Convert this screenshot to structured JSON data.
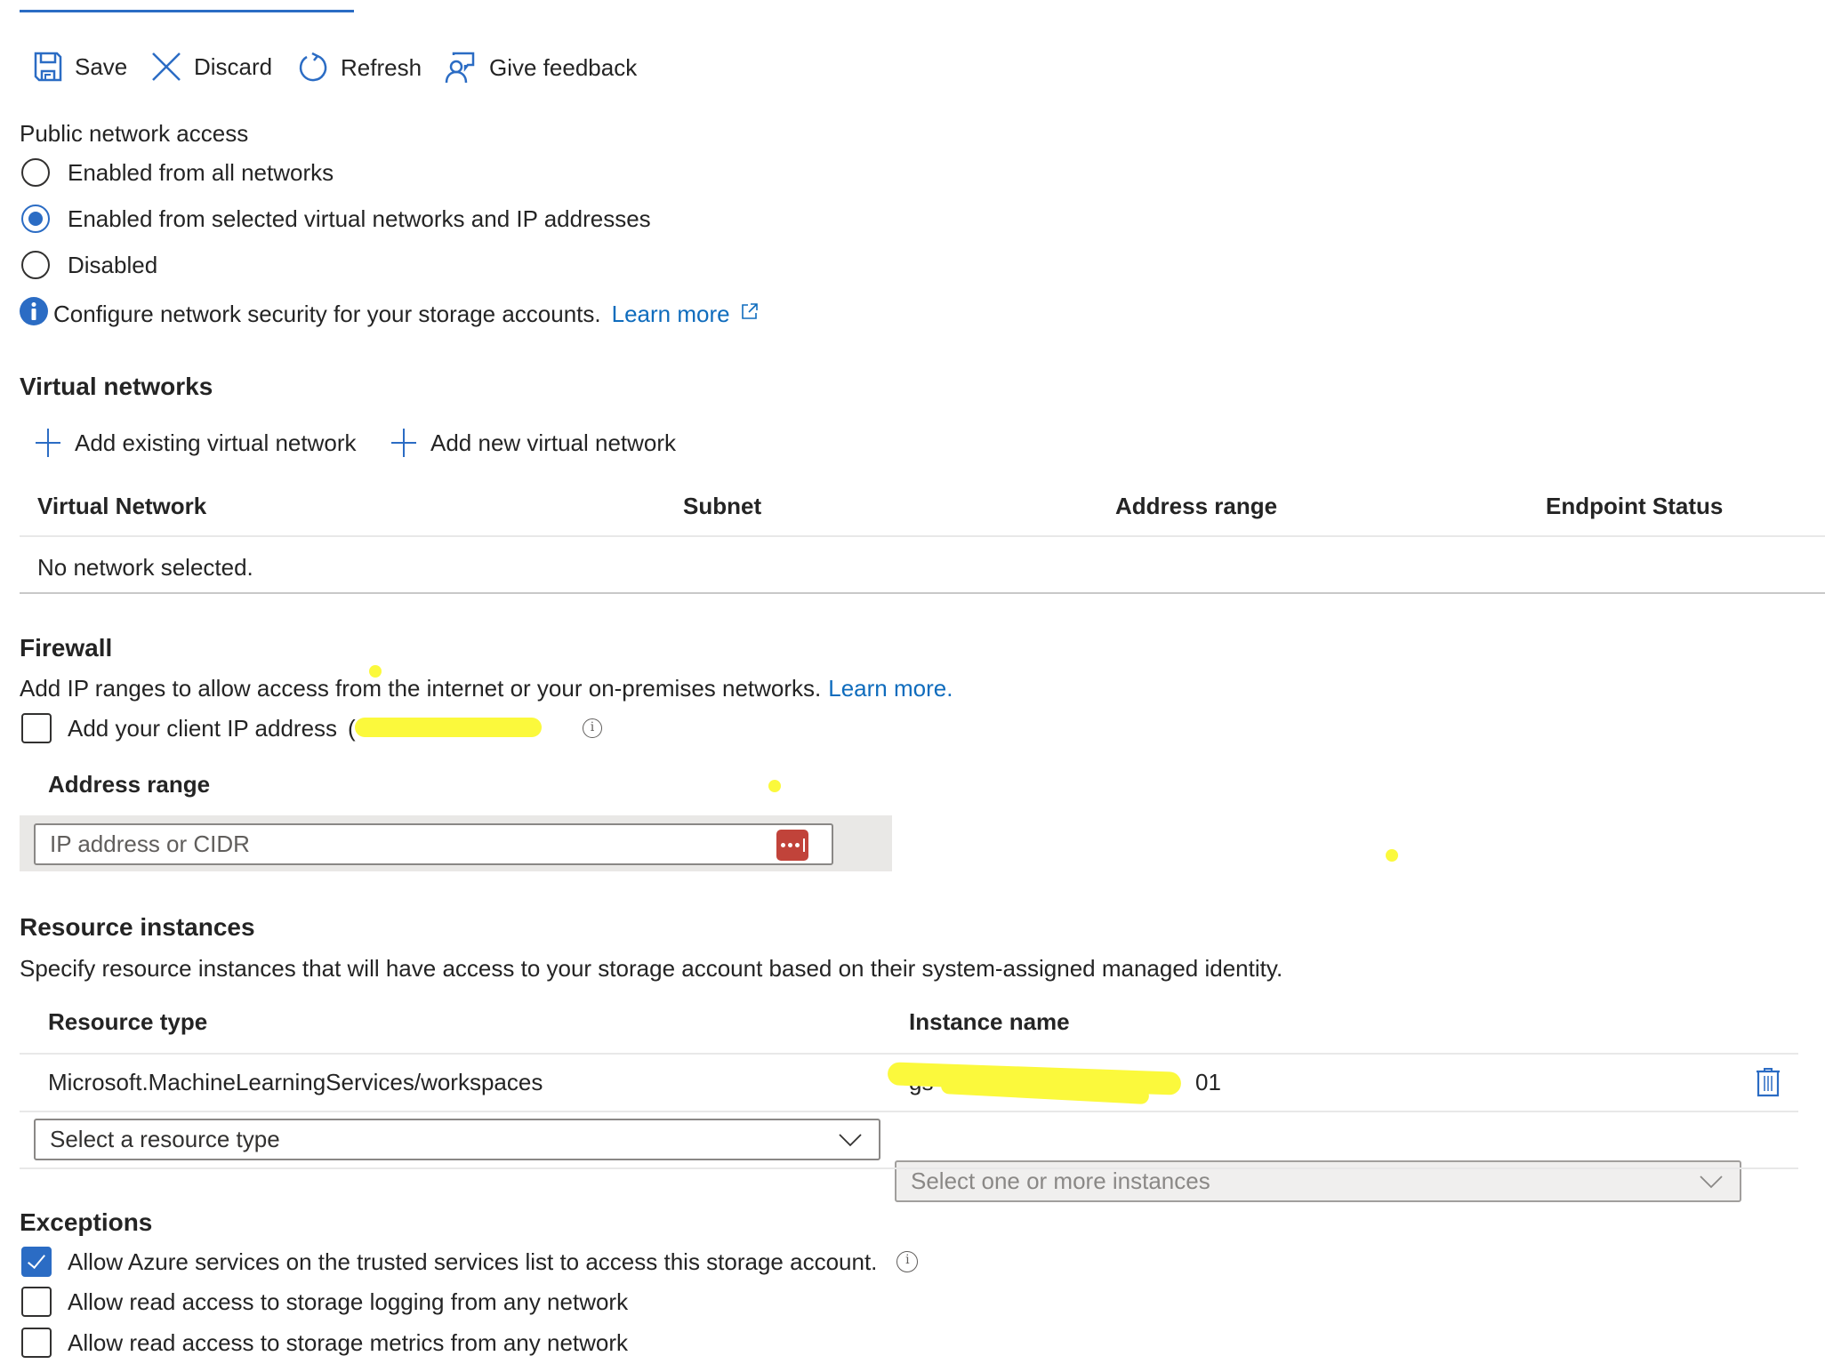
{
  "toolbar": {
    "save_label": "Save",
    "discard_label": "Discard",
    "refresh_label": "Refresh",
    "feedback_label": "Give feedback"
  },
  "public_access": {
    "title": "Public network access",
    "options": [
      {
        "label": "Enabled from all networks",
        "selected": false
      },
      {
        "label": "Enabled from selected virtual networks and IP addresses",
        "selected": true
      },
      {
        "label": "Disabled",
        "selected": false
      }
    ],
    "info_text": "Configure network security for your storage accounts.",
    "learn_more": "Learn more"
  },
  "virtual_networks": {
    "title": "Virtual networks",
    "add_existing": "Add existing virtual network",
    "add_new": "Add new virtual network",
    "columns": [
      "Virtual Network",
      "Subnet",
      "Address range",
      "Endpoint Status"
    ],
    "empty_text": "No network selected."
  },
  "firewall": {
    "title": "Firewall",
    "description": "Add IP ranges to allow access from the internet or your on-premises networks.",
    "learn_more": "Learn more.",
    "client_ip_label": "Add your client IP address",
    "client_ip_value_redacted": "(",
    "client_ip_checked": false,
    "address_range_label": "Address range",
    "address_placeholder": "IP address or CIDR"
  },
  "resource_instances": {
    "title": "Resource instances",
    "description": "Specify resource instances that will have access to your storage account based on their system-assigned managed identity.",
    "columns": [
      "Resource type",
      "Instance name"
    ],
    "rows": [
      {
        "resource_type": "Microsoft.MachineLearningServices/workspaces",
        "instance_name_visible_start": "gs",
        "instance_name_visible_end": "01"
      }
    ],
    "resource_type_placeholder": "Select a resource type",
    "instances_placeholder": "Select one or more instances"
  },
  "exceptions": {
    "title": "Exceptions",
    "items": [
      {
        "label": "Allow Azure services on the trusted services list to access this storage account.",
        "checked": true
      },
      {
        "label": "Allow read access to storage logging from any network",
        "checked": false
      },
      {
        "label": "Allow read access to storage metrics from any network",
        "checked": false
      }
    ]
  },
  "colors": {
    "accent": "#2b6cc4",
    "link": "#0f6cbd",
    "password_manager": "#c1433a",
    "highlight": "#fbf93c"
  }
}
